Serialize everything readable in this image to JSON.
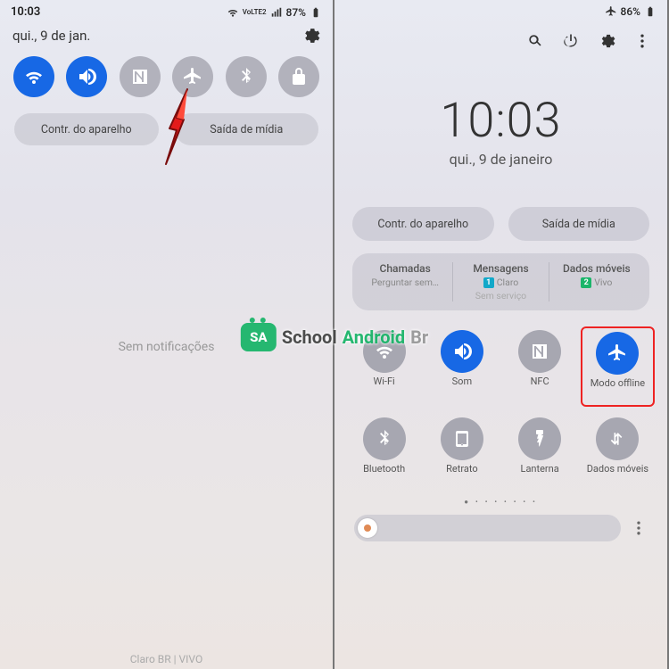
{
  "left": {
    "status_time": "10:03",
    "status_network": "VoLTE2",
    "battery_pct": "87%",
    "date": "qui., 9 de jan.",
    "qs": [
      {
        "name": "wifi",
        "active": true
      },
      {
        "name": "sound",
        "active": true
      },
      {
        "name": "nfc",
        "active": false
      },
      {
        "name": "airplane",
        "active": false
      },
      {
        "name": "bluetooth",
        "active": false
      },
      {
        "name": "lock",
        "active": false
      }
    ],
    "oval1": "Contr. do aparelho",
    "oval2": "Saída de mídia",
    "empty_text": "Sem notificações",
    "footer": "Claro BR | VIVO"
  },
  "right": {
    "battery_pct": "86%",
    "clock": "10:03",
    "date": "qui., 9 de janeiro",
    "oval1": "Contr. do aparelho",
    "oval2": "Saída de mídia",
    "sim": {
      "chamadas_title": "Chamadas",
      "chamadas_sub": "Perguntar sem…",
      "mensagens_title": "Mensagens",
      "mensagens_sub": "Claro",
      "mensagens_sub2": "Sem serviço",
      "dados_title": "Dados móveis",
      "dados_sub": "Vivo"
    },
    "grid": [
      {
        "name": "wifi",
        "label": "Wi-Fi",
        "active": false
      },
      {
        "name": "sound",
        "label": "Som",
        "active": true
      },
      {
        "name": "nfc",
        "label": "NFC",
        "active": false
      },
      {
        "name": "airplane",
        "label": "Modo offline",
        "active": true,
        "highlight": true
      },
      {
        "name": "bluetooth",
        "label": "Bluetooth",
        "active": false
      },
      {
        "name": "portrait",
        "label": "Retrato",
        "active": false
      },
      {
        "name": "flashlight",
        "label": "Lanterna",
        "active": false
      },
      {
        "name": "data",
        "label": "Dados móveis",
        "active": false
      }
    ]
  },
  "watermark": {
    "badge": "SA",
    "t1": "School",
    "t2": "Android",
    "t3": "Br"
  }
}
